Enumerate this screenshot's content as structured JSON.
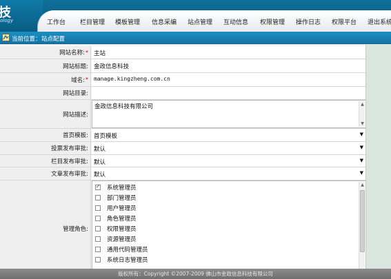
{
  "header": {
    "logo_text": "技",
    "logo_subtext": "ology",
    "nav": [
      "工作台",
      "栏目管理",
      "模板管理",
      "信息采编",
      "站点管理",
      "互动信息",
      "权限管理",
      "操作日志",
      "权限平台",
      "退出系统"
    ]
  },
  "location": {
    "label": "当前位置：",
    "value": "站点配置"
  },
  "form": {
    "site_name": {
      "label": "网站名称:",
      "required": "*",
      "value": "主站"
    },
    "site_title": {
      "label": "网站标题:",
      "value": "金政信息科技"
    },
    "domain": {
      "label": "域名:",
      "required": "*",
      "value": "manage.kingzheng.com.cn"
    },
    "site_dir": {
      "label": "网站目录:",
      "value": ""
    },
    "site_desc": {
      "label": "网站描述:",
      "value": "金政信息科技有限公司"
    },
    "home_template": {
      "label": "首页模板:",
      "value": "首页模板"
    },
    "vote_approval": {
      "label": "投票发布审批:",
      "value": "默认"
    },
    "column_approval": {
      "label": "栏目发布审批:",
      "value": "默认"
    },
    "article_approval": {
      "label": "文章发布审批:",
      "value": "默认"
    },
    "admin_roles": {
      "label": "管理角色:",
      "options": [
        {
          "label": "系统管理员",
          "checked": true
        },
        {
          "label": "部门管理员",
          "checked": false
        },
        {
          "label": "用户管理员",
          "checked": false
        },
        {
          "label": "角色管理员",
          "checked": false
        },
        {
          "label": "权限管理员",
          "checked": false
        },
        {
          "label": "资源管理员",
          "checked": false
        },
        {
          "label": "通用代码管理员",
          "checked": false
        },
        {
          "label": "系统日志管理员",
          "checked": false
        }
      ]
    }
  },
  "footer": {
    "text": "版权所有：Copyright ©2007-2009 佛山市金政信息科技有限公司"
  }
}
